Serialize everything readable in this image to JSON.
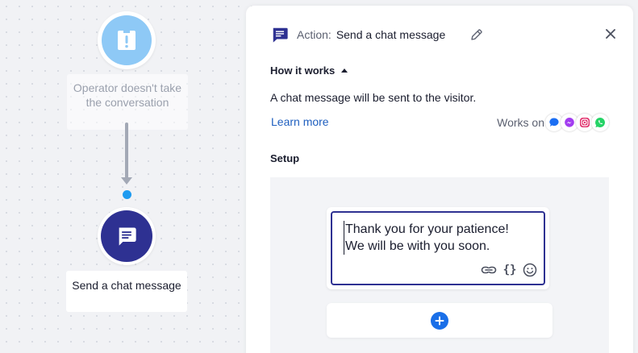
{
  "canvas": {
    "trigger_node": {
      "icon": "alert-icon",
      "label": "Operator doesn't take the conversation"
    },
    "action_node": {
      "icon": "chat-message-icon",
      "label": "Send a chat message"
    }
  },
  "panel": {
    "header": {
      "prefix": "Action:",
      "title": "Send a chat message"
    },
    "how_it_works": {
      "label": "How it works",
      "expanded": true
    },
    "description": "A chat message will be sent to the visitor.",
    "learn_more": "Learn more",
    "works_on": {
      "label": "Works on",
      "channels": [
        "livechat-icon",
        "messenger-icon",
        "instagram-icon",
        "whatsapp-icon"
      ]
    },
    "setup": {
      "heading": "Setup",
      "message": "Thank you for your patience!\nWe will be with you soon.",
      "tools": [
        "link-icon",
        "variables-icon",
        "emoji-icon"
      ],
      "vars_glyph": "{}"
    }
  },
  "colors": {
    "accent": "#2e3192",
    "trigger": "#8ec9f6",
    "link": "#1f5fbf",
    "add_button": "#1a6fe8",
    "connector_dot": "#1e9bf0"
  }
}
